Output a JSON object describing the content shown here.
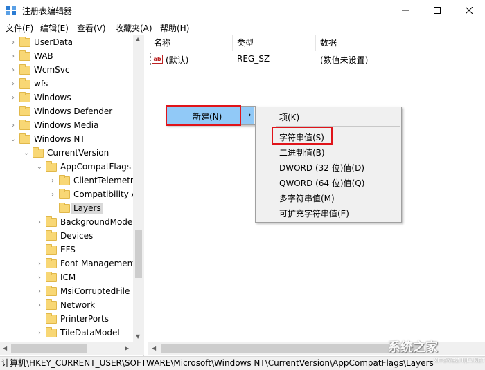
{
  "window": {
    "title": "注册表编辑器"
  },
  "menubar": {
    "items": [
      "文件(F)",
      "编辑(E)",
      "查看(V)",
      "收藏夹(A)",
      "帮助(H)"
    ]
  },
  "tree": {
    "items": [
      {
        "label": "UserData"
      },
      {
        "label": "WAB"
      },
      {
        "label": "WcmSvc"
      },
      {
        "label": "wfs"
      },
      {
        "label": "Windows"
      },
      {
        "label": "Windows Defender"
      },
      {
        "label": "Windows Media"
      },
      {
        "label": "Windows NT"
      },
      {
        "label": "CurrentVersion"
      },
      {
        "label": "AppCompatFlags"
      },
      {
        "label": "ClientTelemetr"
      },
      {
        "label": "Compatibility A"
      },
      {
        "label": "Layers"
      },
      {
        "label": "BackgroundMode"
      },
      {
        "label": "Devices"
      },
      {
        "label": "EFS"
      },
      {
        "label": "Font Management"
      },
      {
        "label": "ICM"
      },
      {
        "label": "MsiCorruptedFile"
      },
      {
        "label": "Network"
      },
      {
        "label": "PrinterPorts"
      },
      {
        "label": "TileDataModel"
      }
    ]
  },
  "list": {
    "columns": [
      "名称",
      "类型",
      "数据"
    ],
    "rows": [
      {
        "name": "(默认)",
        "type": "REG_SZ",
        "data": "(数值未设置)"
      }
    ]
  },
  "context_menu": {
    "new_label": "新建(N)",
    "submenu": [
      "项(K)",
      "字符串值(S)",
      "二进制值(B)",
      "DWORD (32 位)值(D)",
      "QWORD (64 位)值(Q)",
      "多字符串值(M)",
      "可扩充字符串值(E)"
    ]
  },
  "statusbar": {
    "path": "计算机\\HKEY_CURRENT_USER\\SOFTWARE\\Microsoft\\Windows NT\\CurrentVersion\\AppCompatFlags\\Layers"
  },
  "watermark": {
    "text": "系统之家",
    "sub": "XITONGZHIJIA.NET"
  }
}
